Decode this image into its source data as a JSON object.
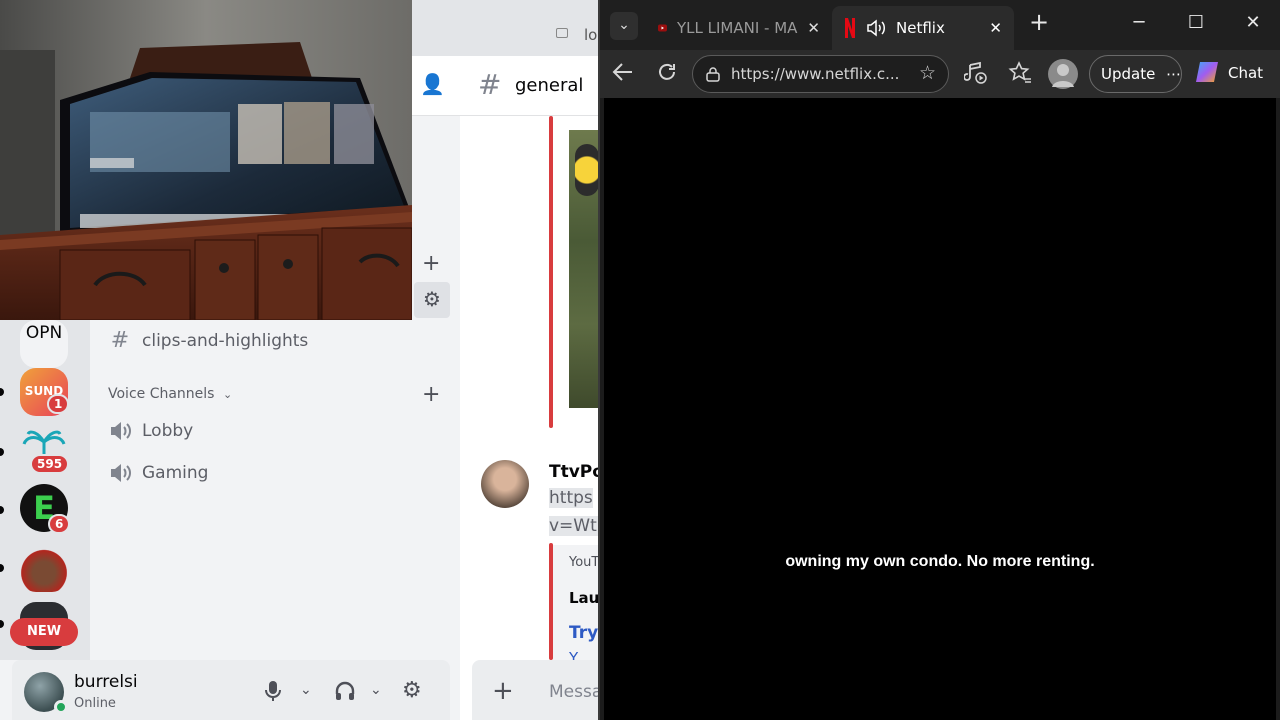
{
  "discord": {
    "search_fragment": "lo",
    "channel_header": {
      "title": "general"
    },
    "guild_bar": {
      "guilds": [
        {
          "label": "OPN",
          "badge": ""
        },
        {
          "label": "SUND",
          "badge": "1"
        },
        {
          "label": "",
          "badge": "595"
        },
        {
          "label": "E",
          "badge": "6"
        },
        {
          "label": "",
          "badge": ""
        },
        {
          "label": "",
          "badge": ""
        }
      ],
      "new_pill": "NEW"
    },
    "channels": {
      "text": [
        {
          "name": "clips-and-highlights"
        }
      ],
      "voice_section": "Voice Channels",
      "voice": [
        {
          "name": "Lobby"
        },
        {
          "name": "Gaming"
        }
      ]
    },
    "messages": {
      "author": "TtvPo",
      "link_line1": "https",
      "link_line2": "v=Wtl",
      "embed_provider": "YouT",
      "embed_title": "Lau",
      "embed_link": "Try",
      "embed_more": "Y"
    },
    "input": {
      "placeholder": "Messa"
    },
    "user": {
      "name": "burrelsi",
      "status": "Online"
    }
  },
  "browser": {
    "tabs": [
      {
        "title": "YLL LIMANI - MA"
      },
      {
        "title": "Netflix"
      }
    ],
    "address": "https://www.netflix.c...",
    "update_label": "Update",
    "chat_label": "Chat",
    "subtitle": "owning my own condo. No more renting."
  },
  "colors": {
    "discord_accent": "#d83c3e",
    "online": "#23a55a",
    "netflix_red": "#e50914",
    "youtube_red": "#ff0000"
  }
}
